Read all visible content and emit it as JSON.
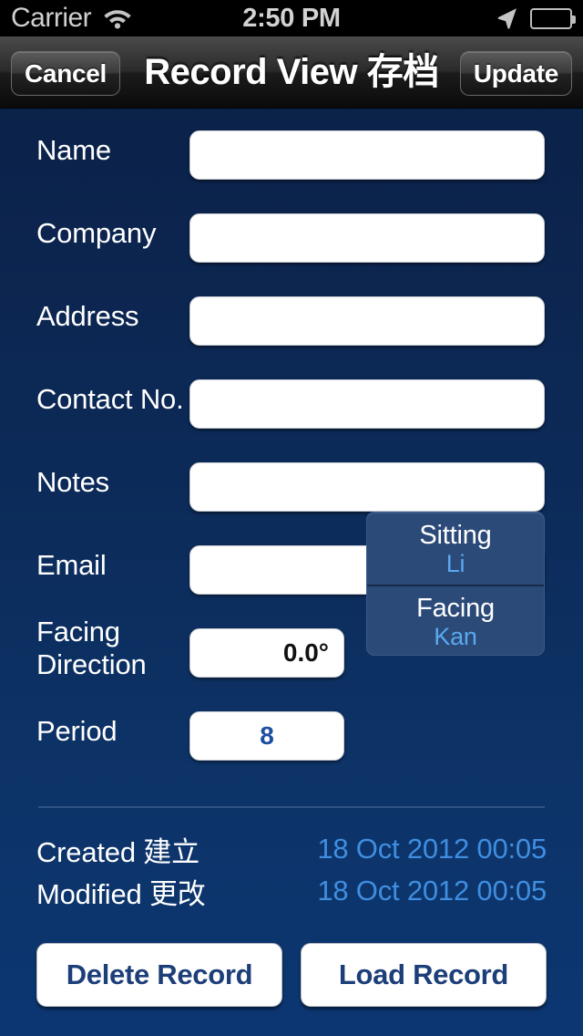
{
  "status_bar": {
    "carrier": "Carrier",
    "time": "2:50 PM",
    "wifi_icon": "wifi-icon",
    "location_icon": "location-arrow-icon",
    "battery_icon": "battery-icon"
  },
  "nav_bar": {
    "cancel_label": "Cancel",
    "title": "Record View 存档",
    "update_label": "Update"
  },
  "form": {
    "fields": [
      {
        "label": "Name",
        "value": "",
        "placeholder": ""
      },
      {
        "label": "Company",
        "value": "",
        "placeholder": ""
      },
      {
        "label": "Address",
        "value": "",
        "placeholder": ""
      },
      {
        "label": "Contact No.",
        "value": "",
        "placeholder": ""
      },
      {
        "label": "Notes",
        "value": "",
        "placeholder": ""
      },
      {
        "label": "Email",
        "value": "",
        "placeholder": ""
      }
    ],
    "facing_direction": {
      "label": "Facing\nDirection",
      "value": "0.0°"
    },
    "period": {
      "label": "Period",
      "value": "8"
    }
  },
  "orientation": {
    "sitting": {
      "title": "Sitting",
      "value": "Li"
    },
    "facing": {
      "title": "Facing",
      "value": "Kan"
    }
  },
  "meta": {
    "created": {
      "label": "Created 建立",
      "value": "18 Oct 2012 00:05"
    },
    "modified": {
      "label": "Modified 更改",
      "value": "18 Oct 2012 00:05"
    }
  },
  "actions": {
    "delete_label": "Delete Record",
    "load_label": "Load Record"
  },
  "colors": {
    "background_top": "#0b1f44",
    "background_bottom": "#0c3672",
    "accent_blue": "#3f8ee0",
    "panel_blue": "#2b4a78",
    "panel_value_blue": "#5aa8f0",
    "button_text_navy": "#1d3f79",
    "nav_bar_black": "#1b1b1b"
  }
}
